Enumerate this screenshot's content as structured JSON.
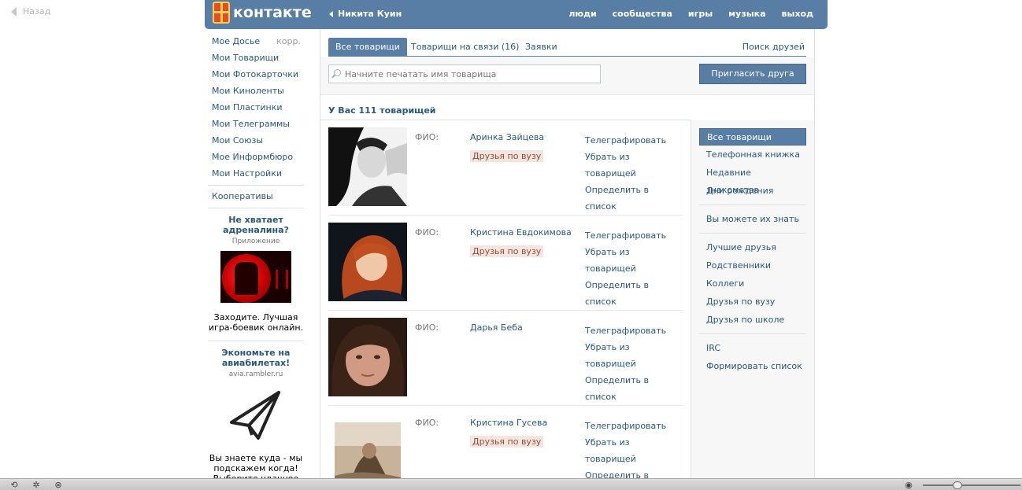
{
  "back": {
    "label": "Назад"
  },
  "header": {
    "logo_text": "контакте",
    "user_name": "Никита Куин",
    "nav": [
      "люди",
      "сообщества",
      "игры",
      "музыка",
      "выход"
    ]
  },
  "left_menu": {
    "items": [
      {
        "label": "Мое Досье",
        "extra": "корр."
      },
      {
        "label": "Мои Товарищи"
      },
      {
        "label": "Мои Фотокарточки"
      },
      {
        "label": "Мои Киноленты"
      },
      {
        "label": "Мои Пластинки"
      },
      {
        "label": "Мои Телеграммы"
      },
      {
        "label": "Мои Союзы"
      },
      {
        "label": "Мое Информбюро"
      },
      {
        "label": "Мои Настройки"
      }
    ],
    "coop": "Кооперативы"
  },
  "ads": [
    {
      "title": "Не хватает адреналина?",
      "sub": "Приложение",
      "text": "Заходите. Лучшая игра-боевик онлайн."
    },
    {
      "title": "Экономьте на авиабилетах!",
      "sub": "avia.rambler.ru",
      "text": "Вы знаете куда - мы подскажем когда! Выберите удачное"
    }
  ],
  "tabs": [
    {
      "label": "Все товарищи",
      "active": true
    },
    {
      "label": "Товарищи на связи (16)",
      "active": false
    },
    {
      "label": "Заявки",
      "active": false
    }
  ],
  "tab_right": "Поиск друзей",
  "search": {
    "placeholder": "Начните печатать имя товарища",
    "value": ""
  },
  "invite_button": "Пригласить друга",
  "summary": "У Вас 111 товарищей",
  "friends": [
    {
      "fio_label": "ФИО:",
      "name": "Аринка Зайцева",
      "badge": "Друзья по вузу",
      "actions": [
        "Телеграфировать",
        "Убрать из товарищей",
        "Определить в список"
      ]
    },
    {
      "fio_label": "ФИО:",
      "name": "Кристина Евдокимова",
      "badge": "Друзья по вузу",
      "actions": [
        "Телеграфировать",
        "Убрать из товарищей",
        "Определить в список"
      ]
    },
    {
      "fio_label": "ФИО:",
      "name": "Дарья Беба",
      "badge": "",
      "actions": [
        "Телеграфировать",
        "Убрать из товарищей",
        "Определить в список"
      ]
    },
    {
      "fio_label": "ФИО:",
      "name": "Кристина Гусева",
      "badge": "Друзья по вузу",
      "actions": [
        "Телеграфировать",
        "Убрать из товарищей",
        "Определить в список"
      ]
    }
  ],
  "filters": {
    "group1": [
      "Все товарищи",
      "Телефонная книжка",
      "Недавние знакомства",
      "Дни рождения"
    ],
    "group2": [
      "Вы можете их знать"
    ],
    "group3": [
      "Лучшие друзья",
      "Родственники",
      "Коллеги",
      "Друзья по вузу",
      "Друзья по школе"
    ],
    "group4": [
      "IRC",
      "Формировать список"
    ]
  },
  "colors": {
    "header": "#587ea6",
    "link": "#2b587a",
    "badge_bg": "#f6e5de"
  }
}
